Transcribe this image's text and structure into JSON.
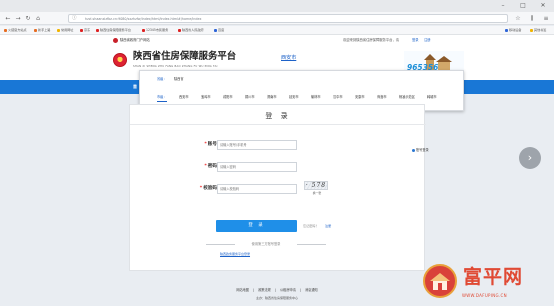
{
  "browser": {
    "url": "hzzl.shaanxizfbz.cn:9080/sxzhzfw/index/html/index.html#/home/index",
    "bookmarks": [
      {
        "label": "火狐官方站点",
        "color": "#e66d22"
      },
      {
        "label": "新手上路",
        "color": "#e66d22"
      },
      {
        "label": "常用网址",
        "color": "#f0b400"
      },
      {
        "label": "京东",
        "color": "#d22"
      },
      {
        "label": "陕西住房保障服务平台",
        "color": "#d22"
      },
      {
        "label": "12345市民服务",
        "color": "#d22"
      },
      {
        "label": "陕西省人民政府",
        "color": "#d22"
      },
      {
        "label": "百度",
        "color": "#2e65d8"
      }
    ],
    "bookmarks_right": [
      {
        "label": "移动设备",
        "color": "#2e65d8"
      },
      {
        "label": "其他书签",
        "color": "#f0b400"
      }
    ],
    "window_buttons": [
      "–",
      "□",
      "✕"
    ]
  },
  "topstrip": {
    "site_link": "陕西省政府门户网站",
    "welcome": "欢迎来到陕西省住房保障服务平台，请",
    "login": "登录",
    "register": "注册"
  },
  "header": {
    "title": "陕西省住房保障服务平台",
    "subtitle": "SHAN XI SHENG ZHU FANG BAO ZHANG FU WU PING TAI",
    "city": "西安市",
    "hotline": "965356"
  },
  "nav": {
    "first_item": "首"
  },
  "city_popup": {
    "row1_label": "省级：",
    "row1_items": [
      "陕西省"
    ],
    "row2_label": "市级：",
    "row2_items": [
      "西安市",
      "宝鸡市",
      "咸阳市",
      "铜川市",
      "渭南市",
      "延安市",
      "榆林市",
      "汉中市",
      "安康市",
      "商洛市",
      "杨凌示范区",
      "韩城市"
    ]
  },
  "login": {
    "title": "登 录",
    "account_label": "账号",
    "account_placeholder": "请输入账号/手机号",
    "password_label": "密码",
    "password_placeholder": "请输入密码",
    "captcha_label": "校验码",
    "captcha_placeholder": "请输入校验码",
    "captcha_text": "· 578",
    "captcha_refresh": "换一张",
    "submit": "登 录",
    "forgot": "忘记密码？",
    "register": "注册",
    "divider": "使用第三方账号登录",
    "legal_login": "陕西政务服务平台登录"
  },
  "side": {
    "helper": "账号登录"
  },
  "footer": {
    "links": [
      "网站地图",
      "|",
      "政策法规",
      "|",
      "公租房申请",
      "|",
      "消息通知"
    ],
    "copyright": "主办：陕西省住房保障服务中心"
  },
  "watermark": {
    "text": "富平网",
    "url": "WWW.DAFUPING.CN"
  }
}
